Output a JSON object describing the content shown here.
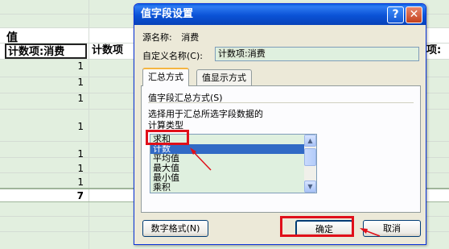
{
  "sheet": {
    "value_header": "值",
    "col1_header": "计数项:消费",
    "col2_header": "计数项",
    "col3_header": "项:",
    "cells": [
      "1",
      "1",
      "1",
      "1",
      "1",
      "1",
      "1"
    ],
    "total": "7"
  },
  "dialog": {
    "title": "值字段设置",
    "help_glyph": "?",
    "close_glyph": "✕",
    "source_label": "源名称:",
    "source_value": "消费",
    "custom_name_label": "自定义名称(C):",
    "custom_name_value": "计数项:消费",
    "tabs": [
      "汇总方式",
      "值显示方式"
    ],
    "group_label": "值字段汇总方式(S)",
    "description_line1": "选择用于汇总所选字段数据的",
    "description_line2": "计算类型",
    "list_items": [
      "求和",
      "计数",
      "平均值",
      "最大值",
      "最小值",
      "乘积"
    ],
    "selected_item": "计数",
    "number_format_button": "数字格式(N)",
    "ok_button": "确定",
    "cancel_button": "取消"
  },
  "colors": {
    "title_bar": "#0a52d6",
    "highlight": "#e0101a",
    "selection": "#316ac5"
  }
}
